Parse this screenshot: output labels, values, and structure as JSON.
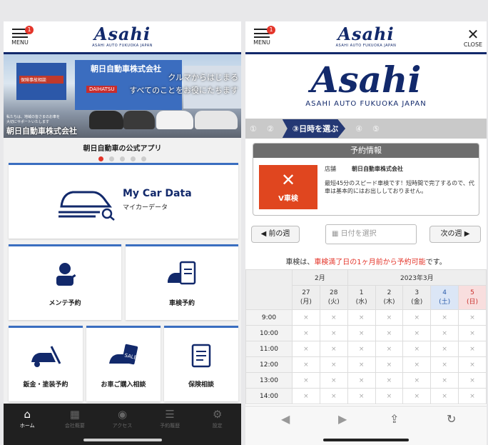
{
  "left": {
    "menu_label": "MENU",
    "menu_badge": "1",
    "logo_word": "Asahi",
    "logo_sub": "ASAHI AUTO FUKUOKA JAPAN",
    "hero": {
      "company_sign": "朝日自動車株式会社",
      "slogan_line1": "クルマからはじまる",
      "slogan_line2": "すべてのことをお役にたちます",
      "caption": "朝日自動車株式会社",
      "small_text_line1": "私たちは、地域の皆さまのお車を",
      "small_text_line2": "大切にサポートいたします",
      "store_sign": "保険事故相談",
      "brand_sign": "DAIHATSU"
    },
    "app_title": "朝日自動車の公式アプリ",
    "carousel": {
      "count": 5,
      "active_index": 0
    },
    "cards": {
      "mycar_title": "My Car Data",
      "mycar_sub": "マイカーデータ",
      "maintenance": "メンテ予約",
      "inspection": "車検予約",
      "bodywork": "鈑金・塗装予約",
      "purchase": "お車ご購入相談",
      "insurance": "保険相談"
    },
    "tabs": [
      {
        "label": "ホーム",
        "icon": "home-icon",
        "active": true
      },
      {
        "label": "会社概要",
        "icon": "building-icon",
        "active": false
      },
      {
        "label": "アクセス",
        "icon": "map-pin-icon",
        "active": false
      },
      {
        "label": "予約履歴",
        "icon": "list-icon",
        "active": false
      },
      {
        "label": "設定",
        "icon": "gear-icon",
        "active": false
      }
    ]
  },
  "right": {
    "menu_label": "MENU",
    "menu_badge": "1",
    "close_label": "CLOSE",
    "logo_word": "Asahi",
    "logo_sub": "ASAHI AUTO FUKUOKA JAPAN",
    "big_logo_sub": "ASAHI AUTO FUKUOKA JAPAN",
    "steps": [
      "①",
      "②",
      "③日時を選ぶ",
      "④",
      "⑤"
    ],
    "reservation": {
      "header": "予約情報",
      "service_label": "V車検",
      "store_label": "店舗",
      "store_name": "朝日自動車株式会社",
      "desc": "最短45分のスピード車検です！短時間で完了するので、代車は基本的にはお出ししておりません。"
    },
    "prev_week": "前の週",
    "next_week": "次の週",
    "date_placeholder": "日付を選択",
    "notice_prefix": "車検は、",
    "notice_red": "車検満了日の1ヶ月前から予約可能",
    "notice_suffix": "です。",
    "calendar": {
      "month_feb": "2月",
      "month_mar": "2023年3月",
      "days": [
        {
          "num": "27",
          "dow": "(月)",
          "kind": "weekday"
        },
        {
          "num": "28",
          "dow": "(火)",
          "kind": "weekday"
        },
        {
          "num": "1",
          "dow": "(水)",
          "kind": "weekday"
        },
        {
          "num": "2",
          "dow": "(木)",
          "kind": "weekday"
        },
        {
          "num": "3",
          "dow": "(金)",
          "kind": "weekday"
        },
        {
          "num": "4",
          "dow": "(土)",
          "kind": "sat"
        },
        {
          "num": "5",
          "dow": "(日)",
          "kind": "sun"
        }
      ],
      "times": [
        "9:00",
        "10:00",
        "11:00",
        "12:00",
        "13:00",
        "14:00"
      ],
      "slot_mark": "×"
    },
    "browser_icons": [
      "back-arrow-icon",
      "forward-arrow-icon",
      "share-icon",
      "reload-icon"
    ],
    "colors": {
      "navy": "#12296b",
      "accent_red": "#e4352a",
      "service_orange": "#e0461f"
    }
  }
}
